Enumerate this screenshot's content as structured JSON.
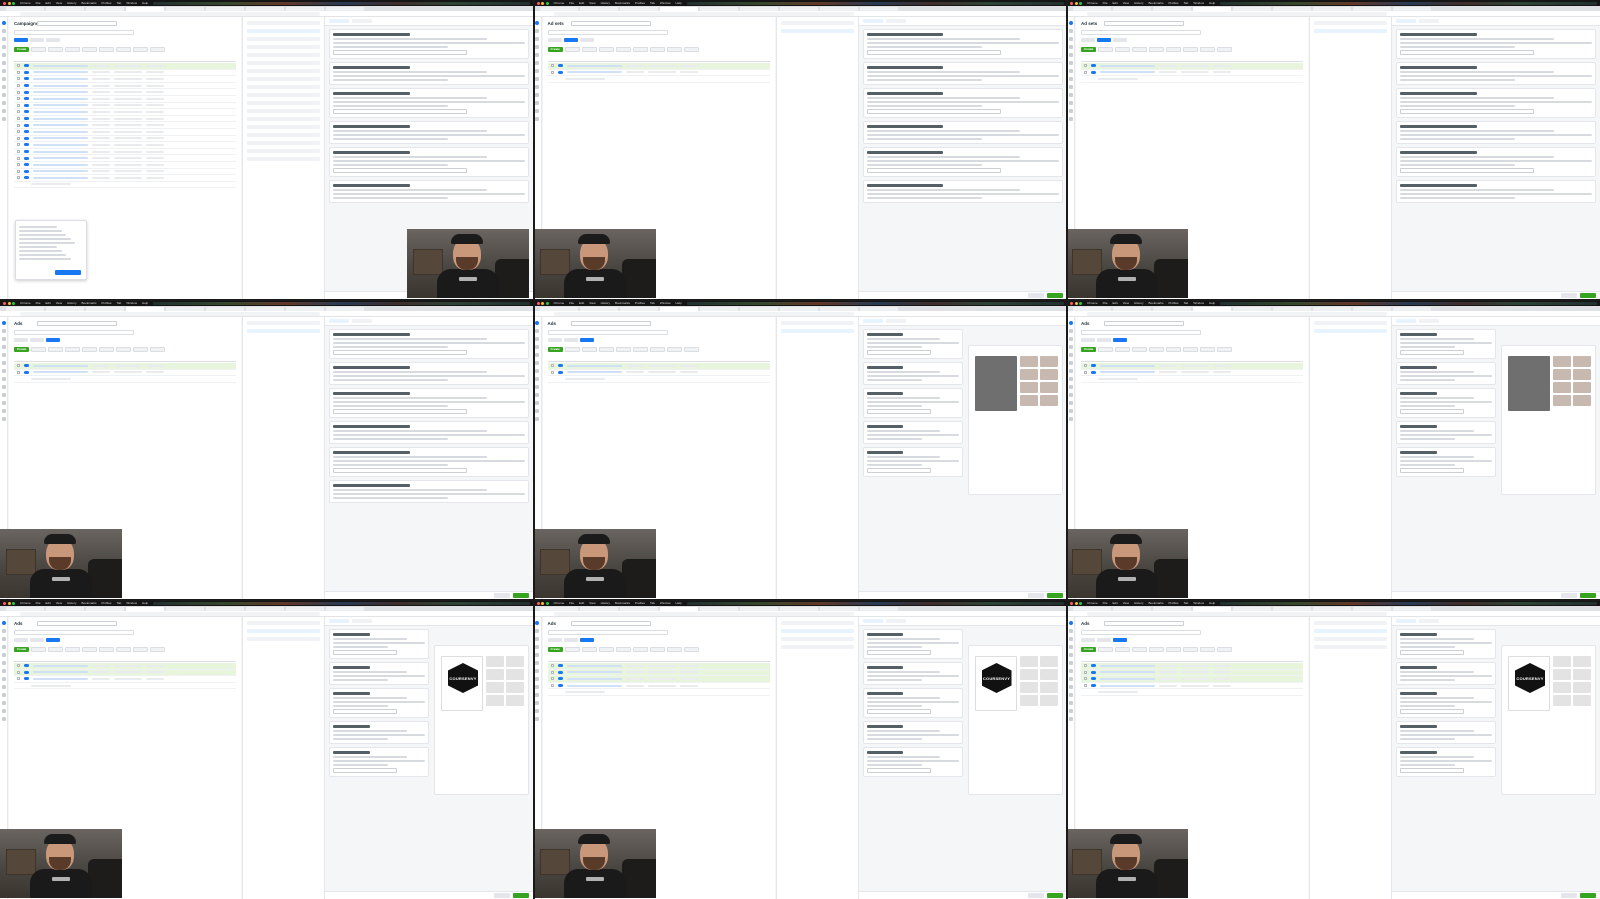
{
  "window": {
    "menu_items": [
      "Chrome",
      "File",
      "Edit",
      "View",
      "History",
      "Bookmarks",
      "Profiles",
      "Tab",
      "Window",
      "Help"
    ]
  },
  "colors": {
    "brand_blue": "#1877f2",
    "create_green": "#36a420",
    "selected_row": "#e7f5dc",
    "menubar": "#151515"
  },
  "icons": [
    "meta-logo-icon",
    "search-icon",
    "gear-icon",
    "close-icon",
    "chevron-down-icon",
    "checkbox-icon",
    "toggle-icon"
  ],
  "tiles": [
    {
      "id": "t1",
      "list_title": "Campaigns",
      "rows": 18,
      "selected_rows": 1,
      "edit_panel": "campaign",
      "preview": "none",
      "popup": true
    },
    {
      "id": "t2",
      "list_title": "Ad sets",
      "rows": 2,
      "selected_rows": 1,
      "edit_panel": "adset",
      "preview": "none",
      "popup": false
    },
    {
      "id": "t3",
      "list_title": "Ad sets",
      "rows": 2,
      "selected_rows": 1,
      "edit_panel": "adset",
      "preview": "none",
      "popup": false
    },
    {
      "id": "t4",
      "list_title": "Ads",
      "rows": 2,
      "selected_rows": 1,
      "edit_panel": "ad",
      "preview": "none",
      "popup": false
    },
    {
      "id": "t5",
      "list_title": "Ads",
      "rows": 2,
      "selected_rows": 1,
      "edit_panel": "ad",
      "preview": "product",
      "popup": false
    },
    {
      "id": "t6",
      "list_title": "Ads",
      "rows": 2,
      "selected_rows": 1,
      "edit_panel": "ad",
      "preview": "product",
      "popup": false
    },
    {
      "id": "t7",
      "list_title": "Ads",
      "rows": 3,
      "selected_rows": 2,
      "edit_panel": "ad",
      "preview": "logo",
      "popup": false
    },
    {
      "id": "t8",
      "list_title": "Ads",
      "rows": 4,
      "selected_rows": 3,
      "edit_panel": "ad",
      "preview": "logo",
      "popup": false
    },
    {
      "id": "t9",
      "list_title": "Ads",
      "rows": 4,
      "selected_rows": 3,
      "edit_panel": "ad",
      "preview": "logo",
      "popup": false
    }
  ],
  "logo_text": "COURSENVY",
  "list": {
    "create_label": "Create"
  }
}
